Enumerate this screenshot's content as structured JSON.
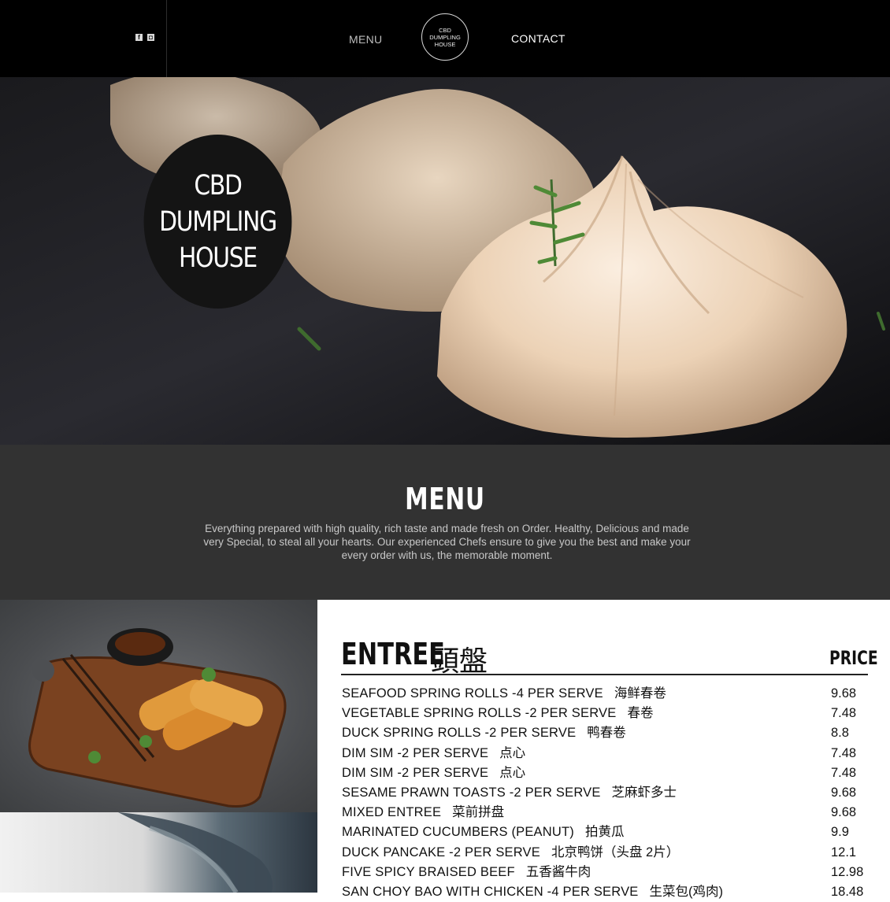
{
  "header": {
    "social": [
      {
        "icon": "facebook-icon",
        "glyph": "f"
      },
      {
        "icon": "instagram-icon",
        "glyph": "◘"
      }
    ],
    "nav_menu": "MENU",
    "nav_contact": "CONTACT",
    "logo_lines": [
      "CBD",
      "DUMPLING",
      "HOUSE"
    ]
  },
  "hero": {
    "badge_lines": [
      "CBD",
      "DUMPLING",
      "HOUSE"
    ]
  },
  "intro": {
    "title": "MENU",
    "text": "Everything prepared with high quality, rich taste and made fresh on Order. Healthy, Delicious and made very Special, to steal all your hearts. Our experienced Chefs ensure to give you the best and make your every order with us, the memorable moment."
  },
  "menu": {
    "section_title": "ENTREE",
    "section_title_zh": "頭盤",
    "price_header": "PRICE",
    "items": [
      {
        "en": "SEAFOOD SPRING ROLLS -4 PER SERVE",
        "zh": "海鲜春卷",
        "price": "9.68"
      },
      {
        "en": "VEGETABLE SPRING ROLLS -2 PER SERVE",
        "zh": "春卷",
        "price": "7.48"
      },
      {
        "en": "DUCK SPRING ROLLS -2 PER SERVE",
        "zh": "鸭春卷",
        "price": "8.8"
      },
      {
        "en": "DIM SIM -2 PER SERVE",
        "zh": "点心",
        "price": "7.48"
      },
      {
        "en": "DIM SIM -2 PER SERVE",
        "zh": "点心",
        "price": "7.48"
      },
      {
        "en": "SESAME PRAWN TOASTS -2 PER SERVE",
        "zh": "芝麻虾多士",
        "price": "9.68"
      },
      {
        "en": "MIXED ENTREE",
        "zh": "菜前拼盘",
        "price": "9.68"
      },
      {
        "en": "MARINATED CUCUMBERS (PEANUT)",
        "zh": "拍黄瓜",
        "price": "9.9"
      },
      {
        "en": "DUCK PANCAKE -2 PER SERVE",
        "zh": "北京鸭饼（头盘 2片）",
        "price": "12.1"
      },
      {
        "en": "FIVE SPICY BRAISED BEEF",
        "zh": "五香酱牛肉",
        "price": "12.98"
      },
      {
        "en": "SAN CHOY BAO WITH CHICKEN -4 PER SERVE",
        "zh": "生菜包(鸡肉)",
        "price": "18.48"
      }
    ]
  }
}
